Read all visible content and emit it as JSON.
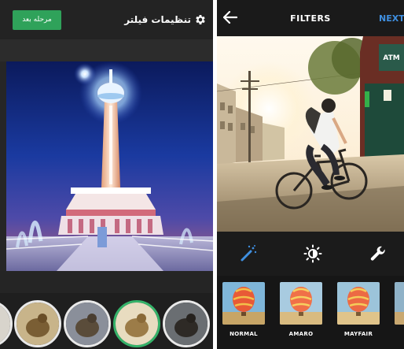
{
  "left_app": {
    "title": "تنظیمات فیلتر",
    "next_button": "مرحله بعد",
    "icons": [
      "gear-icon"
    ],
    "colors": {
      "accent": "#2fa25a",
      "header_bg": "#232323"
    },
    "filter_thumbnails": [
      {
        "state": "normal"
      },
      {
        "state": "normal"
      },
      {
        "state": "normal"
      },
      {
        "state": "selected"
      },
      {
        "state": "normal"
      }
    ]
  },
  "right_app": {
    "title": "FILTERS",
    "next_label": "NEXT",
    "tools": [
      "magic-wand-icon",
      "brightness-icon",
      "wrench-icon"
    ],
    "colors": {
      "next_link": "#3f8fe0",
      "active_tool": "#3f8fe0"
    },
    "filters": [
      {
        "label": "NORMAL"
      },
      {
        "label": "AMARO"
      },
      {
        "label": "MAYFAIR"
      }
    ],
    "signs": {
      "atm": "ATM"
    }
  }
}
